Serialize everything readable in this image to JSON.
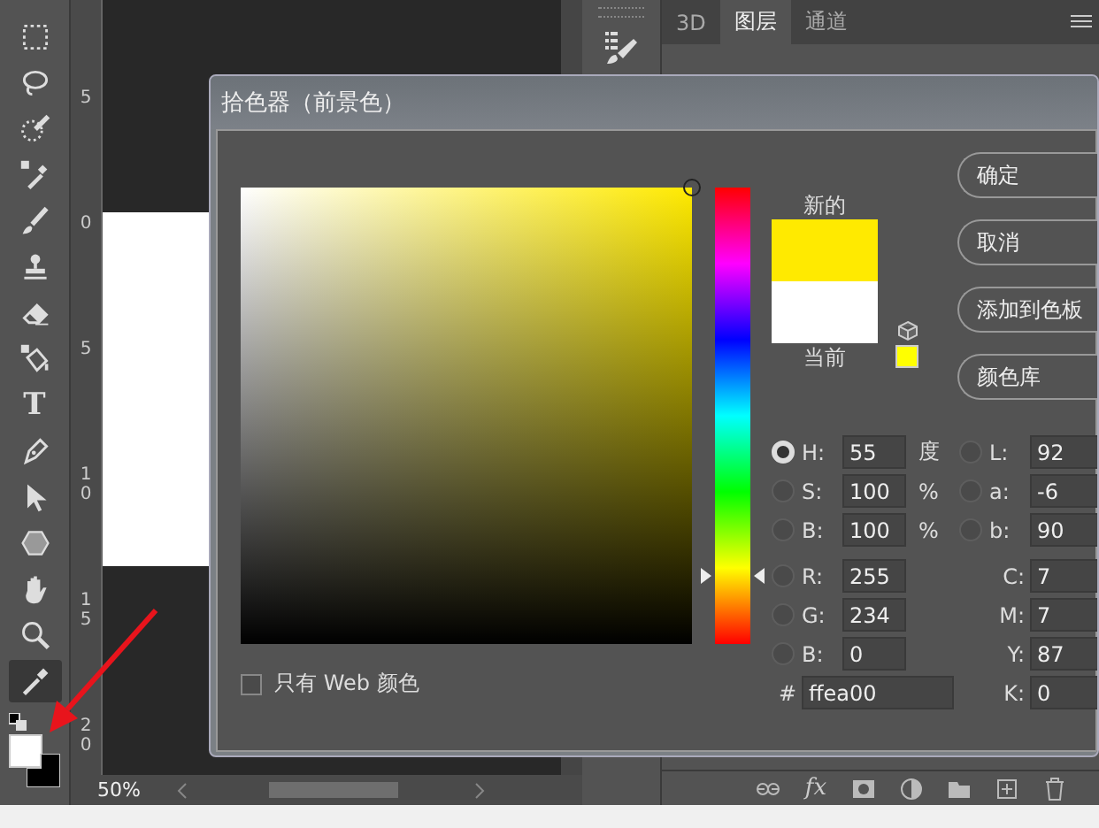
{
  "toolbar": {
    "tools": [
      {
        "kind": "marquee",
        "selected": false
      },
      {
        "kind": "lasso",
        "selected": false
      },
      {
        "kind": "quick-select",
        "selected": false
      },
      {
        "kind": "sampler",
        "selected": false
      },
      {
        "kind": "brush",
        "selected": false
      },
      {
        "kind": "stamp",
        "selected": false
      },
      {
        "kind": "eraser",
        "selected": false
      },
      {
        "kind": "bucket",
        "selected": false
      },
      {
        "kind": "text",
        "label": "T",
        "selected": false
      },
      {
        "kind": "pen",
        "selected": false
      },
      {
        "kind": "pointer",
        "selected": false
      },
      {
        "kind": "hexagon",
        "selected": false
      },
      {
        "kind": "hand",
        "selected": false
      },
      {
        "kind": "zoom",
        "selected": false
      },
      {
        "kind": "eyedropper",
        "selected": true
      }
    ],
    "foreground": {
      "color": "#ffffff"
    },
    "background": {
      "color": "#000000"
    }
  },
  "ruler": {
    "marks": [
      "5",
      "0",
      "5",
      "10",
      "15",
      "20"
    ]
  },
  "status_bar": {
    "zoom": "50%"
  },
  "panel_tabs": [
    {
      "label": "3D",
      "selected": false
    },
    {
      "label": "图层",
      "selected": true
    },
    {
      "label": "通道",
      "selected": false
    }
  ],
  "layer_buttons": [
    {
      "kind": "link"
    },
    {
      "kind": "fx",
      "label": "fx"
    },
    {
      "kind": "mask"
    },
    {
      "kind": "adjust"
    },
    {
      "kind": "folder"
    },
    {
      "kind": "new"
    },
    {
      "kind": "trash"
    }
  ],
  "dialog": {
    "title": "拾色器（前景色）",
    "hue_slider": {
      "level": 0.153
    },
    "web_only": {
      "label": "只有 Web 颜色",
      "checked": false
    },
    "swatches": [
      {
        "label": "新的",
        "color": "#ffea00"
      },
      {
        "label": "当前",
        "color": "#ffffff"
      }
    ],
    "web_safe_swatch": {
      "color": "#ffff00"
    },
    "buttons": [
      "确定",
      "取消",
      "添加到色板",
      "颜色库"
    ],
    "hsb": [
      {
        "label": "H:",
        "value": "55",
        "unit": "度",
        "selected": true
      },
      {
        "label": "S:",
        "value": "100",
        "unit": "%",
        "selected": false
      },
      {
        "label": "B:",
        "value": "100",
        "unit": "%",
        "selected": false
      }
    ],
    "lab": [
      {
        "label": "L:",
        "value": "92",
        "selected": false
      },
      {
        "label": "a:",
        "value": "-6",
        "selected": false
      },
      {
        "label": "b:",
        "value": "90",
        "selected": false
      }
    ],
    "rgb": [
      {
        "label": "R:",
        "value": "255",
        "selected": false
      },
      {
        "label": "G:",
        "value": "234",
        "selected": false
      },
      {
        "label": "B:",
        "value": "0",
        "selected": false
      }
    ],
    "cmyk": [
      {
        "label": "C:",
        "value": "7"
      },
      {
        "label": "M:",
        "value": "7"
      },
      {
        "label": "Y:",
        "value": "87"
      },
      {
        "label": "K:",
        "value": "0"
      }
    ],
    "hex": {
      "label": "#",
      "value": "ffea00"
    }
  }
}
